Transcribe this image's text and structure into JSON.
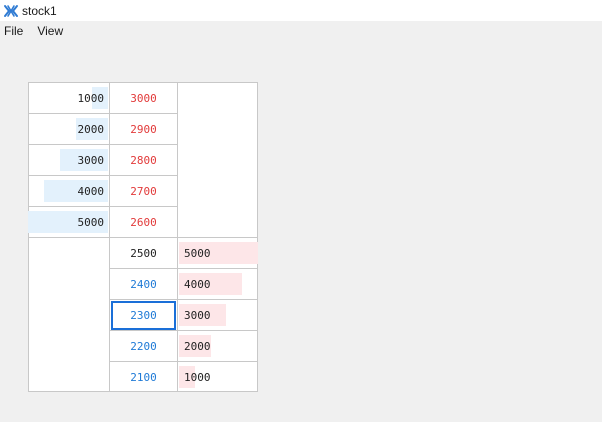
{
  "window": {
    "title": "stock1",
    "icon": "app-logo-icon"
  },
  "menubar": {
    "items": [
      "File",
      "View"
    ]
  },
  "colors": {
    "ask_price": "#e23a3a",
    "bid_price": "#1f7ad6",
    "last_price": "#222222",
    "bid_bar": "#e3f1fc",
    "ask_bar": "#fde6e8",
    "selection": "#1a6fd8"
  },
  "order_book": {
    "upper_rows": [
      {
        "bid_qty": "1000",
        "price": "3000",
        "bar_fraction": 0.2
      },
      {
        "bid_qty": "2000",
        "price": "2900",
        "bar_fraction": 0.4
      },
      {
        "bid_qty": "3000",
        "price": "2800",
        "bar_fraction": 0.6
      },
      {
        "bid_qty": "4000",
        "price": "2700",
        "bar_fraction": 0.8
      },
      {
        "bid_qty": "5000",
        "price": "2600",
        "bar_fraction": 1.0
      }
    ],
    "lower_rows": [
      {
        "price": "2500",
        "ask_qty": "5000",
        "bar_fraction": 1.0,
        "price_kind": "last"
      },
      {
        "price": "2400",
        "ask_qty": "4000",
        "bar_fraction": 0.8,
        "price_kind": "bid"
      },
      {
        "price": "2300",
        "ask_qty": "3000",
        "bar_fraction": 0.6,
        "price_kind": "bid",
        "selected": true
      },
      {
        "price": "2200",
        "ask_qty": "2000",
        "bar_fraction": 0.4,
        "price_kind": "bid"
      },
      {
        "price": "2100",
        "ask_qty": "1000",
        "bar_fraction": 0.2,
        "price_kind": "bid"
      }
    ]
  }
}
